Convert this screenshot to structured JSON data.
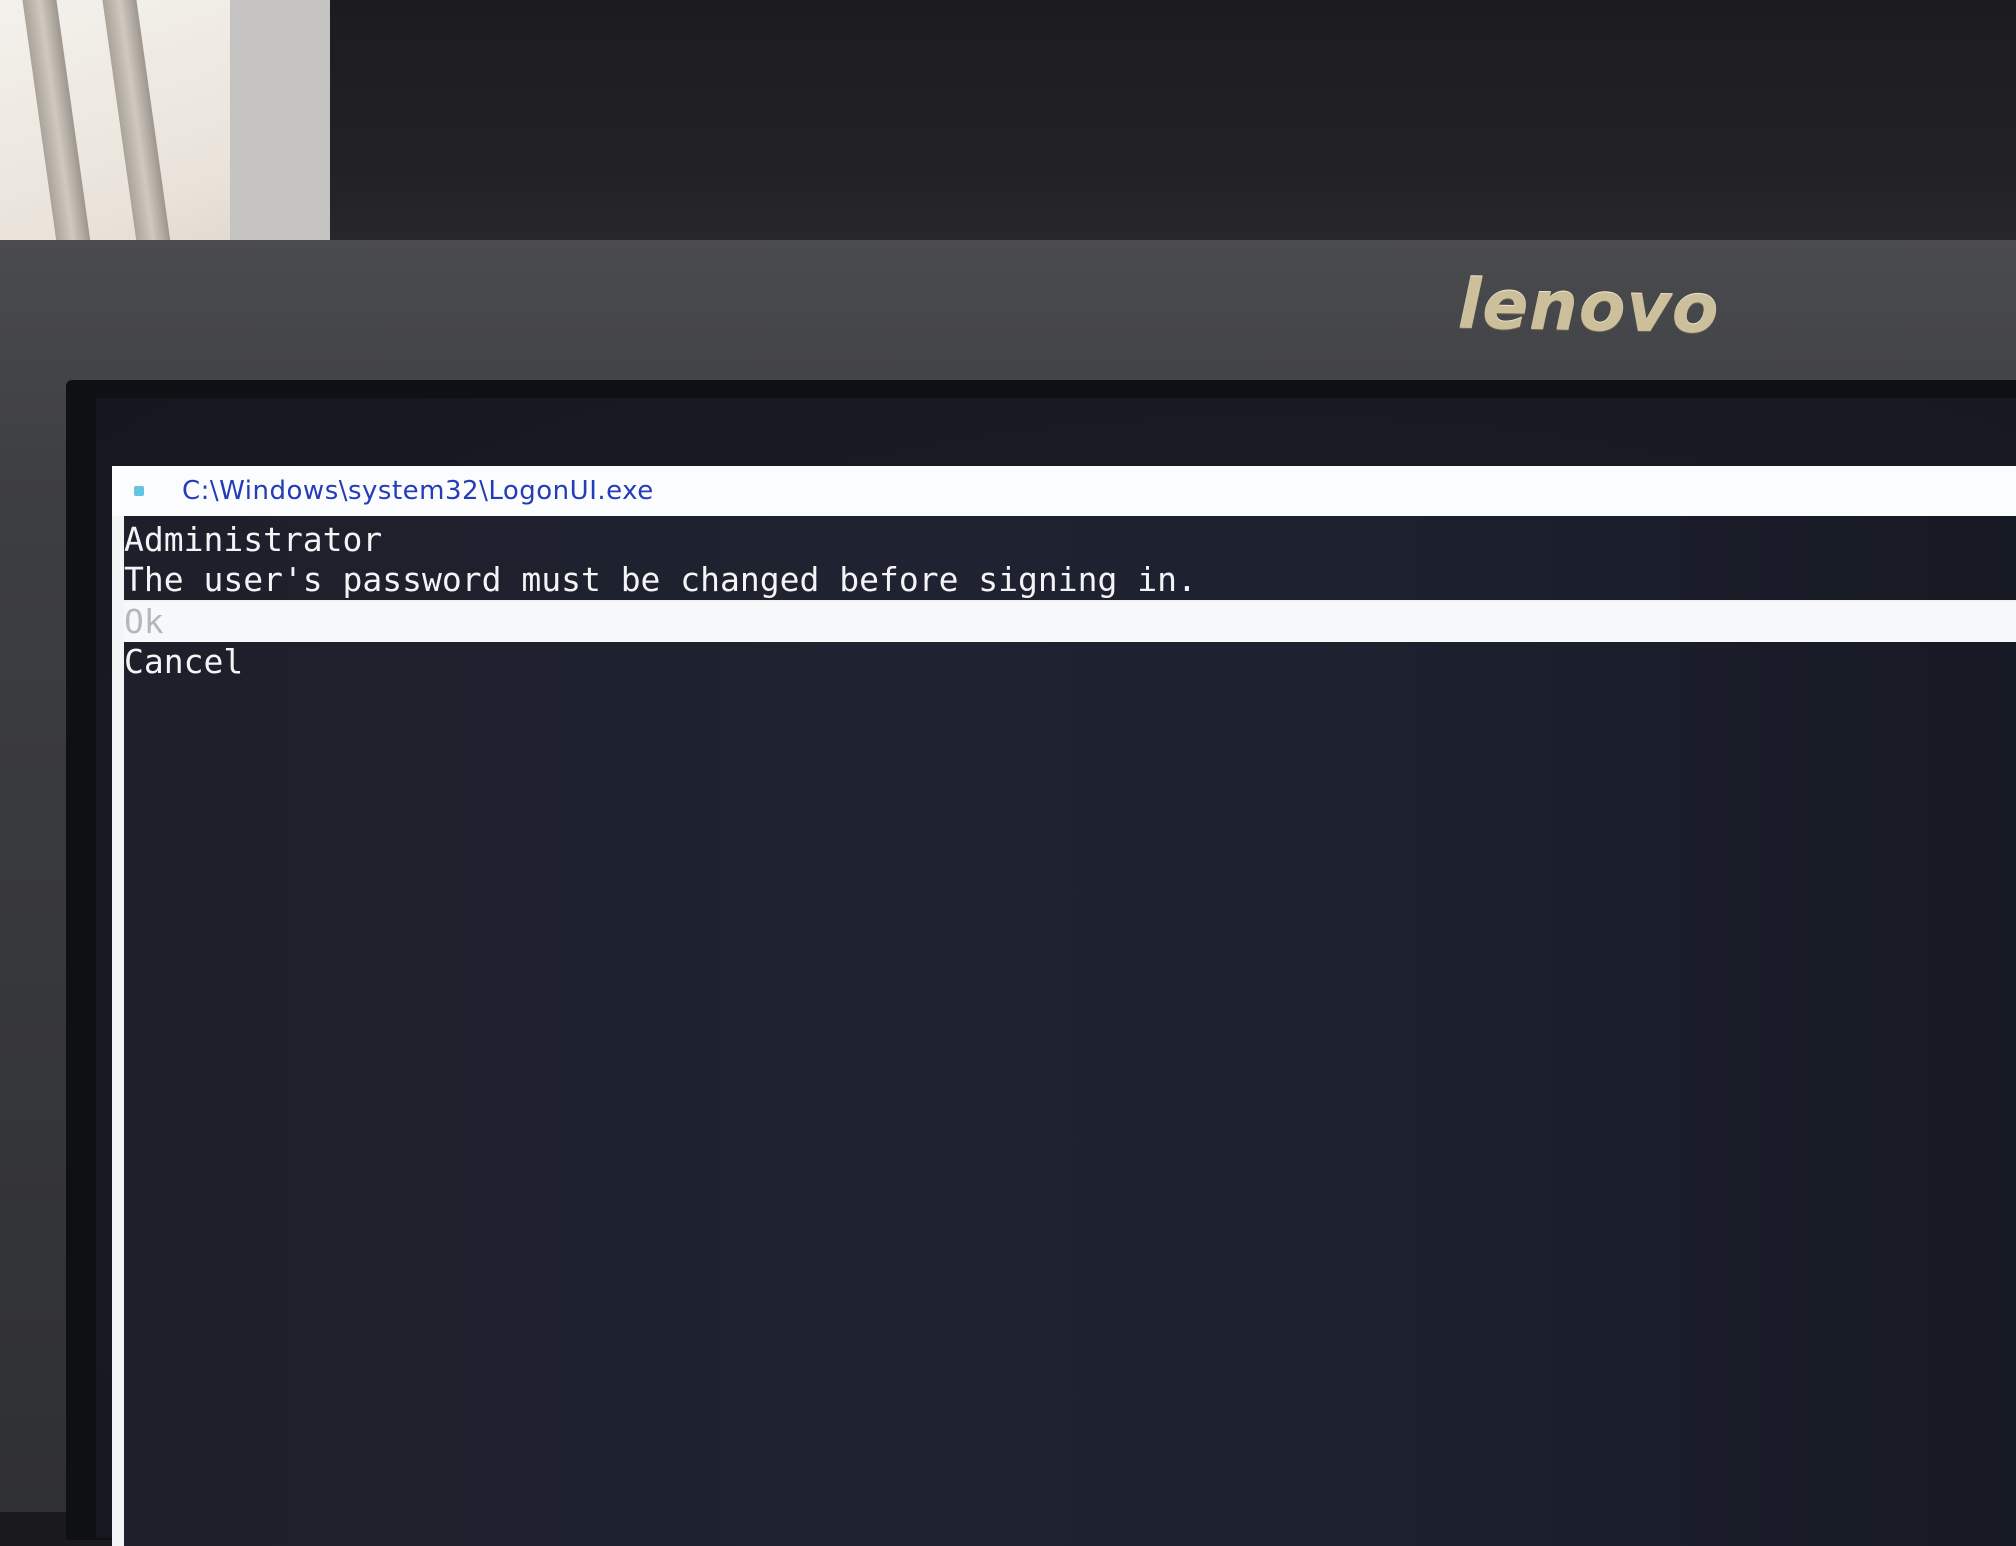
{
  "monitor": {
    "brand": "lenovo"
  },
  "window": {
    "title": "C:\\Windows\\system32\\LogonUI.exe"
  },
  "dialog": {
    "username": "Administrator",
    "message": "The user's password must be changed before signing in.",
    "options": [
      {
        "label": "Ok",
        "selected": true
      },
      {
        "label": "Cancel",
        "selected": false
      }
    ]
  },
  "colors": {
    "title_text": "#253cb8",
    "console_bg": "#1e2130",
    "console_text": "#f4f4f6",
    "selection_bg": "#f7f8f9"
  }
}
